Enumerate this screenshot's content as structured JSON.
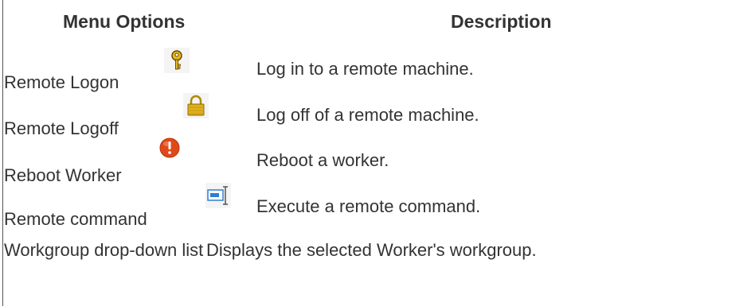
{
  "table": {
    "headers": {
      "menu_options": "Menu Options",
      "description": "Description"
    },
    "rows": [
      {
        "option": "Remote Logon",
        "icon": "key-icon",
        "description": "Log in to a remote machine."
      },
      {
        "option": "Remote Logoff",
        "icon": "lock-icon",
        "description": "Log off of a remote machine."
      },
      {
        "option": "Reboot Worker",
        "icon": "alert-icon",
        "description": "Reboot a worker."
      },
      {
        "option": "Remote command",
        "icon": "remote-command-icon",
        "description": "Execute a remote command."
      },
      {
        "option": "Workgroup drop-down list",
        "icon": "",
        "description": "Displays the selected Worker's workgroup."
      }
    ]
  }
}
